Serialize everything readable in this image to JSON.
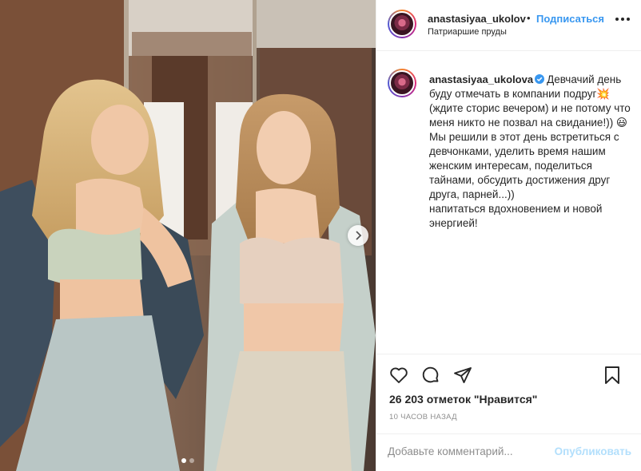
{
  "post": {
    "header": {
      "username": "anastasiyaa_ukolov",
      "separator": "•",
      "follow_label": "Подписаться",
      "location": "Патриаршие пруды"
    },
    "caption": {
      "username": "anastasiyaa_ukolova",
      "text": "Девчачий день буду отмечать в компании подруг💥 (ждите сторис вечером) и не потому что меня никто не позвал на свидание!)) 😃\nМы решили в этот день встретиться с девчонками, уделить время нашим женским интересам, поделиться тайнами, обсудить достижения друг друга, парней...))\nнапитаться вдохновением и новой энергией!"
    },
    "likes": "26 203 отметок \"Нравится\"",
    "timestamp": "10 ЧАСОВ НАЗАД",
    "comment": {
      "placeholder": "Добавьте комментарий...",
      "value": "",
      "publish_label": "Опубликовать"
    },
    "carousel": {
      "current_slide": 1,
      "total_slides": 2
    },
    "icons": {
      "like": "heart-icon",
      "comment": "comment-bubble-icon",
      "share": "paper-plane-icon",
      "save": "bookmark-icon",
      "more": "more-options-icon",
      "next": "chevron-right-icon",
      "verified": "verified-badge-icon"
    },
    "colors": {
      "link_blue": "#3897f0",
      "verified_blue": "#3897f0",
      "publish_disabled": "#b2dffc",
      "muted_text": "#8e8e8e"
    }
  }
}
